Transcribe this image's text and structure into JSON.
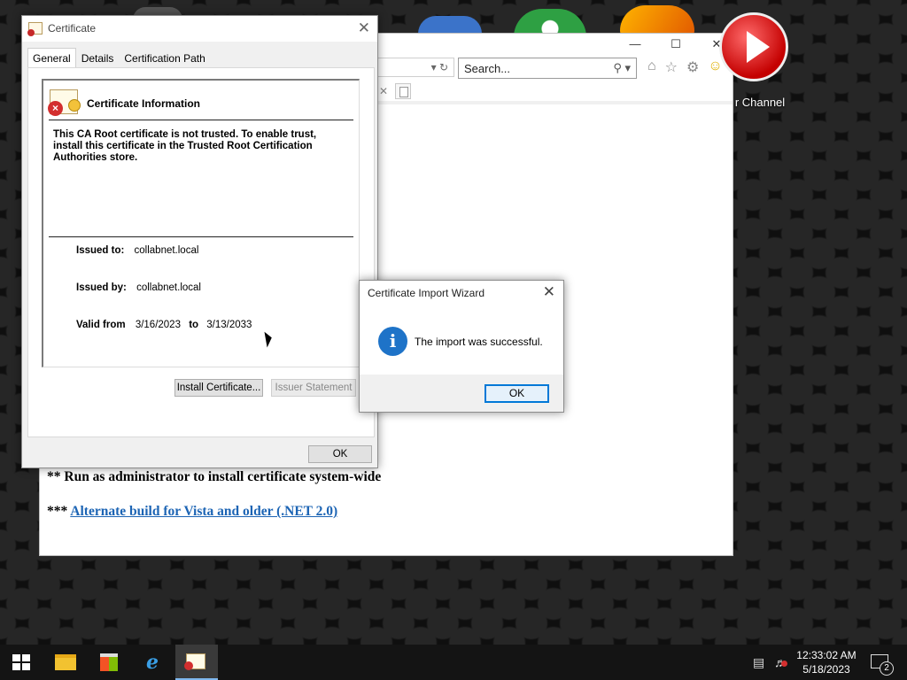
{
  "desktop": {
    "channel_label": "r Channel"
  },
  "browser": {
    "search_placeholder": "Search...",
    "page": {
      "line1": "** Run as administrator to install certificate system-wide",
      "line2_prefix": "*** ",
      "line2_link": "Alternate build for Vista and older (.NET 2.0)"
    }
  },
  "certificate_dialog": {
    "title": "Certificate",
    "tabs": [
      "General",
      "Details",
      "Certification Path"
    ],
    "active_tab": "General",
    "info_heading": "Certificate Information",
    "message": "This CA Root certificate is not trusted. To enable trust, install this certificate in the Trusted Root Certification Authorities store.",
    "issued_to_label": "Issued to:",
    "issued_to": "collabnet.local",
    "issued_by_label": "Issued by:",
    "issued_by": "collabnet.local",
    "valid_from_label": "Valid from",
    "valid_from": "3/16/2023",
    "valid_to_label": "to",
    "valid_to": "3/13/2033",
    "install_button": "Install Certificate...",
    "issuer_statement_button": "Issuer Statement",
    "ok_button": "OK"
  },
  "import_wizard": {
    "title": "Certificate Import Wizard",
    "message": "The import was successful.",
    "ok_button": "OK",
    "icon": "info-icon"
  },
  "taskbar": {
    "time": "12:33:02 AM",
    "date": "5/18/2023",
    "notification_count": "2"
  }
}
